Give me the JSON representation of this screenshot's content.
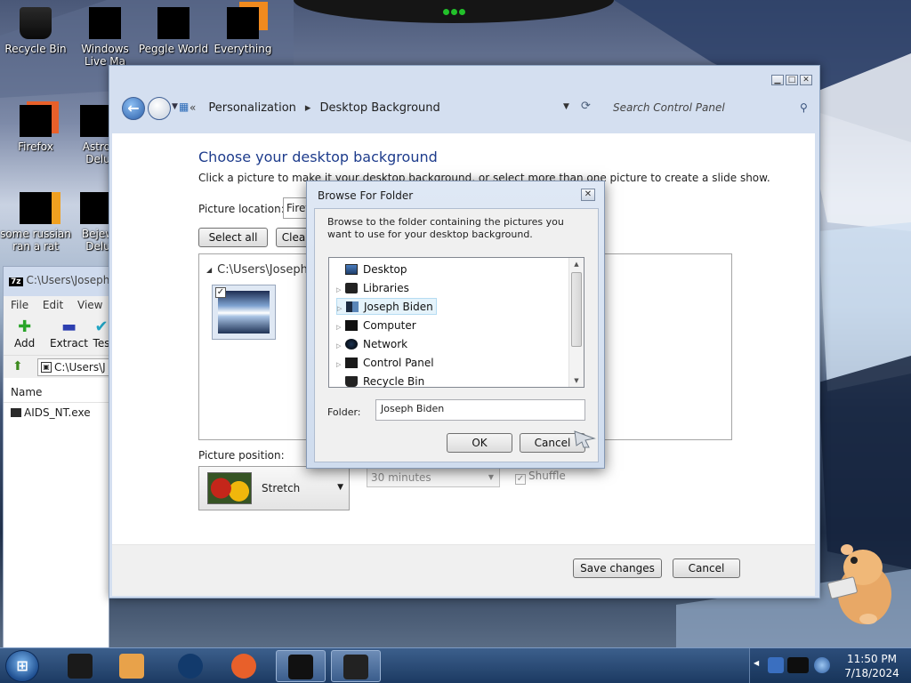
{
  "desktop": {
    "icons": [
      {
        "label": "Recycle Bin",
        "icon": "recycle-bin-icon"
      },
      {
        "label": "Windows Live Ma",
        "icon": "windows-live-mail-icon"
      },
      {
        "label": "Peggle World",
        "icon": "peggle-icon"
      },
      {
        "label": "Everything",
        "icon": "everything-search-icon"
      },
      {
        "label": "Firefox",
        "icon": "firefox-icon"
      },
      {
        "label": "Astrol Delu",
        "icon": "astropop-icon"
      },
      {
        "label": "some russian ran a rat",
        "icon": "ie-like-icon"
      },
      {
        "label": "Bejew Delu",
        "icon": "bejeweled-icon"
      }
    ]
  },
  "control_panel": {
    "breadcrumb": [
      "Personalization",
      "Desktop Background"
    ],
    "search_placeholder": "Search Control Panel",
    "heading": "Choose your desktop background",
    "subtitle": "Click a picture to make it your desktop background, or select more than one picture to create a slide show.",
    "picture_location_label": "Picture location:",
    "picture_location_value": "Firef",
    "select_all": "Select all",
    "clear_all": "Clea",
    "group_label": "C:\\Users\\Joseph",
    "picture_position_label": "Picture position:",
    "picture_position_value": "Stretch",
    "interval_value": "30 minutes",
    "shuffle_label": "Shuffle",
    "save_changes": "Save changes",
    "cancel": "Cancel"
  },
  "sevenzip": {
    "title": "C:\\Users\\Joseph",
    "menu": [
      "File",
      "Edit",
      "View"
    ],
    "tools": [
      {
        "label": "Add",
        "icon": "add-icon",
        "glyph": "✚",
        "color": "#2aa52a"
      },
      {
        "label": "Extract",
        "icon": "extract-icon",
        "glyph": "▬",
        "color": "#2d3fb0"
      },
      {
        "label": "Tes",
        "icon": "test-icon",
        "glyph": "✔",
        "color": "#21a4c4"
      }
    ],
    "path": "C:\\Users\\J",
    "column_name": "Name",
    "files": [
      "AIDS_NT.exe"
    ]
  },
  "browse_dialog": {
    "title": "Browse For Folder",
    "description": "Browse to the folder containing the pictures you want to use for your desktop background.",
    "tree": [
      {
        "label": "Desktop",
        "icon": "desktop-icon",
        "expandable": false,
        "selected": false
      },
      {
        "label": "Libraries",
        "icon": "libraries-icon",
        "expandable": true,
        "selected": false
      },
      {
        "label": "Joseph Biden",
        "icon": "user-folder-icon",
        "expandable": true,
        "selected": true
      },
      {
        "label": "Computer",
        "icon": "computer-icon",
        "expandable": true,
        "selected": false
      },
      {
        "label": "Network",
        "icon": "network-icon",
        "expandable": true,
        "selected": false
      },
      {
        "label": "Control Panel",
        "icon": "control-panel-icon",
        "expandable": true,
        "selected": false
      },
      {
        "label": "Recycle Bin",
        "icon": "recycle-bin-icon",
        "expandable": false,
        "selected": false
      }
    ],
    "folder_label": "Folder:",
    "folder_value": "Joseph Biden",
    "ok": "OK",
    "cancel": "Cancel"
  },
  "taskbar": {
    "buttons": [
      {
        "icon": "explorer-icon",
        "color": "#1a1a1a",
        "active": false
      },
      {
        "icon": "media-player-icon",
        "color": "#e8a24a",
        "active": false
      },
      {
        "icon": "media-center-icon",
        "color": "#123a6c",
        "active": false
      },
      {
        "icon": "firefox-icon",
        "color": "#e8602a",
        "active": false
      },
      {
        "icon": "7zip-icon",
        "color": "#111111",
        "active": true
      },
      {
        "icon": "control-panel-icon",
        "color": "#222222",
        "active": true
      }
    ],
    "time": "11:50 PM",
    "date": "7/18/2024"
  }
}
